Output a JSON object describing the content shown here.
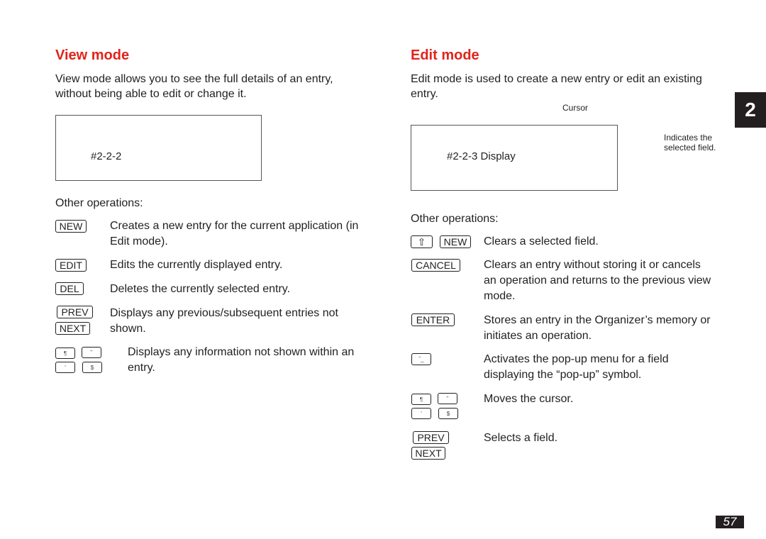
{
  "chapter_tab": "2",
  "page_number": "57",
  "view_mode": {
    "title": "View mode",
    "intro_line1": "View mode allows you to see the full details of an entry,",
    "intro_line2": "without being able to edit or change it.",
    "screen_label": "#2-2-2",
    "other_ops_label": "Other operations:",
    "ops": [
      {
        "keys": [
          "NEW"
        ],
        "line1": "Creates a new entry for the current application (in",
        "line2": "Edit mode)."
      },
      {
        "keys": [
          "EDIT"
        ],
        "line1": "Edits the currently displayed entry."
      },
      {
        "keys": [
          "DEL"
        ],
        "line1": "Deletes the currently selected entry."
      },
      {
        "keys": [
          "PREV",
          "NEXT"
        ],
        "line1": "Displays any previous/subsequent entries not",
        "line2": "shown."
      },
      {
        "keys": [
          "¶",
          "˜",
          "'",
          "$"
        ],
        "line1": "Displays any information not shown within an",
        "line2": "entry."
      }
    ]
  },
  "edit_mode": {
    "title": "Edit mode",
    "intro_line1": "Edit mode is used to create a new entry or edit an existing",
    "intro_line2": "entry.",
    "cursor_label": "Cursor",
    "screen_label": "#2-2-3 Display",
    "field_note_line1": "Indicates the",
    "field_note_line2": "selected field.",
    "other_ops_label": "Other operations:",
    "ops": [
      {
        "keys": [
          "⇧",
          "NEW"
        ],
        "line1": "Clears a selected field."
      },
      {
        "keys": [
          "CANCEL"
        ],
        "line1": "Clears an entry without storing it or cancels",
        "line2": "an operation and returns to the previous view",
        "line3": "mode."
      },
      {
        "keys": [
          "ENTER"
        ],
        "line1": "Stores an entry in the Organizer’s memory or",
        "line2": "initiates an operation."
      },
      {
        "keys": [
          "ˆ_"
        ],
        "line1": "Activates the pop-up menu for a field",
        "line2": "displaying the “pop-up” symbol."
      },
      {
        "keys": [
          "¶",
          "˜",
          "'",
          "$"
        ],
        "line1": "Moves the cursor."
      },
      {
        "keys": [
          "PREV",
          "NEXT"
        ],
        "line1": "Selects a field."
      }
    ]
  }
}
